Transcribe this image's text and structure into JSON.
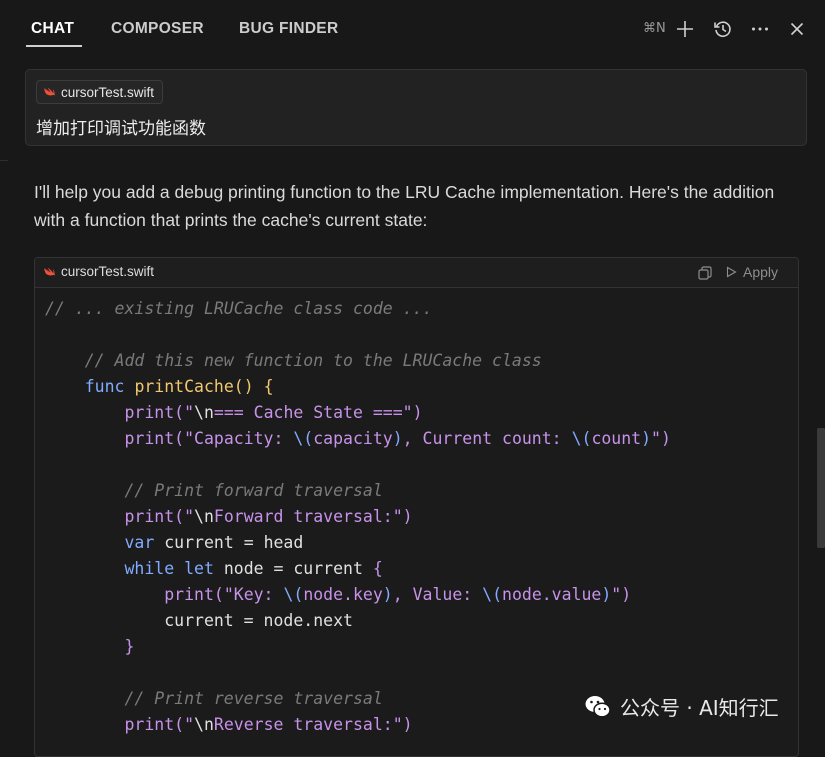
{
  "tabs": [
    {
      "label": "CHAT",
      "active": true
    },
    {
      "label": "COMPOSER",
      "active": false
    },
    {
      "label": "BUG FINDER",
      "active": false
    }
  ],
  "toolbar": {
    "new_chat_shortcut": "⌘N",
    "icons": [
      "plus-icon",
      "history-icon",
      "more-icon",
      "close-icon"
    ]
  },
  "prompt": {
    "file_chip": "cursorTest.swift",
    "text": "增加打印调试功能函数"
  },
  "response": {
    "text": "I'll help you add a debug printing function to the LRU Cache implementation. Here's the addition with a function that prints the cache's current state:"
  },
  "code_block": {
    "filename": "cursorTest.swift",
    "apply_label": "Apply",
    "lines": [
      [
        {
          "t": "// ... existing LRUCache class code ...",
          "c": "comment"
        }
      ],
      [],
      [
        {
          "t": "    // Add this new function to the LRUCache class",
          "c": "comment"
        }
      ],
      [
        {
          "t": "    ",
          "c": "plain"
        },
        {
          "t": "func",
          "c": "kw"
        },
        {
          "t": " ",
          "c": "plain"
        },
        {
          "t": "printCache",
          "c": "fn"
        },
        {
          "t": "() {",
          "c": "paren"
        }
      ],
      [
        {
          "t": "        ",
          "c": "plain"
        },
        {
          "t": "print",
          "c": "call"
        },
        {
          "t": "(\"",
          "c": "str"
        },
        {
          "t": "\\n",
          "c": "plain"
        },
        {
          "t": "=== Cache State ===\")",
          "c": "str"
        }
      ],
      [
        {
          "t": "        ",
          "c": "plain"
        },
        {
          "t": "print",
          "c": "call"
        },
        {
          "t": "(\"Capacity: ",
          "c": "str"
        },
        {
          "t": "\\(",
          "c": "interp"
        },
        {
          "t": "capacity",
          "c": "call"
        },
        {
          "t": ")",
          "c": "interp"
        },
        {
          "t": ", Current count: ",
          "c": "str"
        },
        {
          "t": "\\(",
          "c": "interp"
        },
        {
          "t": "count",
          "c": "call"
        },
        {
          "t": ")",
          "c": "interp"
        },
        {
          "t": "\")",
          "c": "str"
        }
      ],
      [],
      [
        {
          "t": "        // Print forward traversal",
          "c": "comment"
        }
      ],
      [
        {
          "t": "        ",
          "c": "plain"
        },
        {
          "t": "print",
          "c": "call"
        },
        {
          "t": "(\"",
          "c": "str"
        },
        {
          "t": "\\n",
          "c": "plain"
        },
        {
          "t": "Forward traversal:\")",
          "c": "str"
        }
      ],
      [
        {
          "t": "        ",
          "c": "plain"
        },
        {
          "t": "var",
          "c": "kw"
        },
        {
          "t": " current = head",
          "c": "plain"
        }
      ],
      [
        {
          "t": "        ",
          "c": "plain"
        },
        {
          "t": "while",
          "c": "kw"
        },
        {
          "t": " ",
          "c": "plain"
        },
        {
          "t": "let",
          "c": "kw"
        },
        {
          "t": " node = current ",
          "c": "plain"
        },
        {
          "t": "{",
          "c": "brace"
        }
      ],
      [
        {
          "t": "            ",
          "c": "plain"
        },
        {
          "t": "print",
          "c": "call"
        },
        {
          "t": "(\"Key: ",
          "c": "str"
        },
        {
          "t": "\\(",
          "c": "interp"
        },
        {
          "t": "node.key",
          "c": "call"
        },
        {
          "t": ")",
          "c": "interp"
        },
        {
          "t": ", Value: ",
          "c": "str"
        },
        {
          "t": "\\(",
          "c": "interp"
        },
        {
          "t": "node.value",
          "c": "call"
        },
        {
          "t": ")",
          "c": "interp"
        },
        {
          "t": "\")",
          "c": "str"
        }
      ],
      [
        {
          "t": "            current = node.next",
          "c": "plain"
        }
      ],
      [
        {
          "t": "        ",
          "c": "plain"
        },
        {
          "t": "}",
          "c": "brace"
        }
      ],
      [],
      [
        {
          "t": "        // Print reverse traversal",
          "c": "comment"
        }
      ],
      [
        {
          "t": "        ",
          "c": "plain"
        },
        {
          "t": "print",
          "c": "call"
        },
        {
          "t": "(\"",
          "c": "str"
        },
        {
          "t": "\\n",
          "c": "plain"
        },
        {
          "t": "Reverse traversal:\")",
          "c": "str"
        }
      ]
    ]
  },
  "watermark": {
    "text": "公众号 · AI知行汇"
  },
  "colors": {
    "background": "#181818",
    "comment": "#7a7a7a",
    "keyword": "#82aaff",
    "function_name": "#f0c86e",
    "string": "#c792ea",
    "swift_orange": "#f05138"
  }
}
